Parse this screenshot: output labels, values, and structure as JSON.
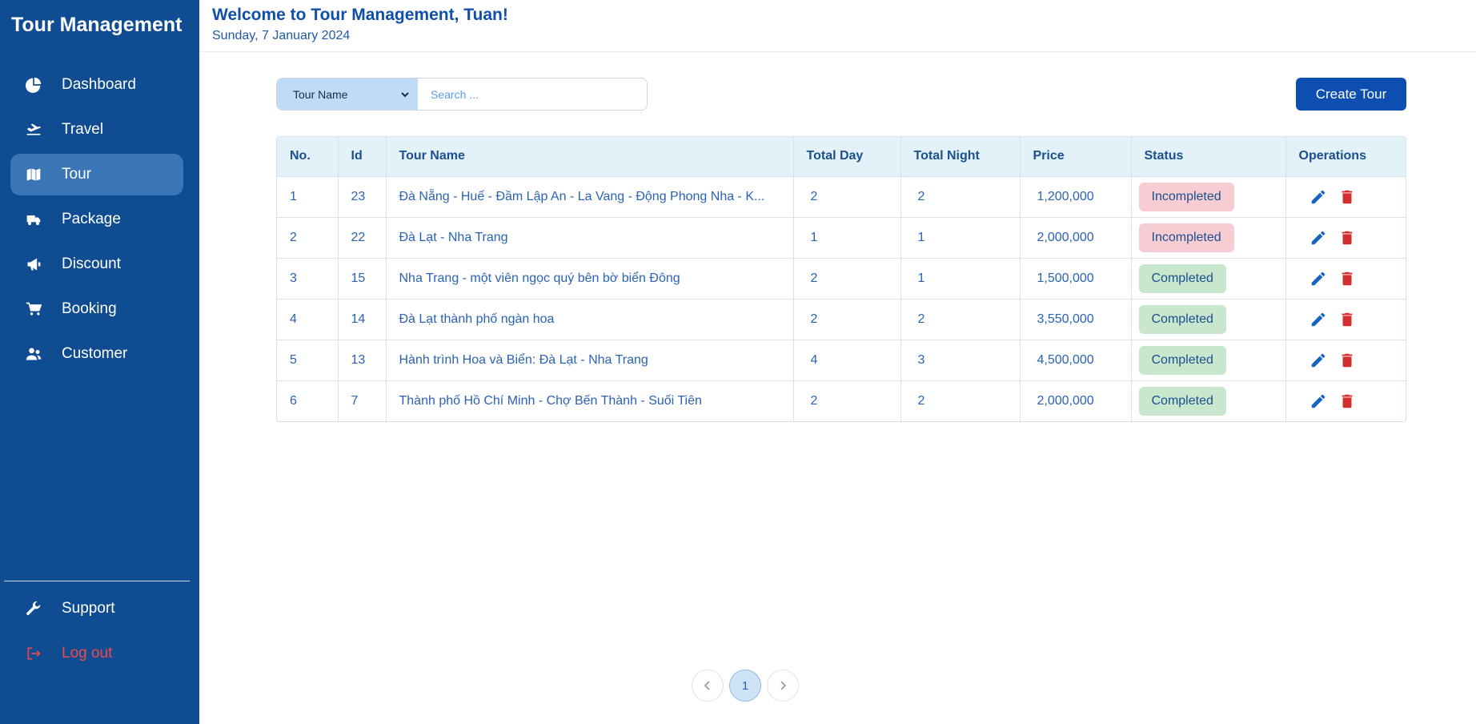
{
  "sidebar": {
    "brand": "Tour Management",
    "items": [
      {
        "label": "Dashboard",
        "icon": "pie-chart-icon"
      },
      {
        "label": "Travel",
        "icon": "plane-icon"
      },
      {
        "label": "Tour",
        "icon": "map-icon",
        "active": true
      },
      {
        "label": "Package",
        "icon": "truck-icon"
      },
      {
        "label": "Discount",
        "icon": "megaphone-icon"
      },
      {
        "label": "Booking",
        "icon": "cart-icon"
      },
      {
        "label": "Customer",
        "icon": "users-icon"
      }
    ],
    "support_label": "Support",
    "logout_label": "Log out"
  },
  "header": {
    "welcome": "Welcome to Tour Management, Tuan!",
    "date": "Sunday, 7 January 2024"
  },
  "search": {
    "select_value": "Tour Name",
    "placeholder": "Search ..."
  },
  "create_label": "Create Tour",
  "table": {
    "columns": [
      "No.",
      "Id",
      "Tour Name",
      "Total Day",
      "Total Night",
      "Price",
      "Status",
      "Operations"
    ],
    "rows": [
      {
        "no": "1",
        "id": "23",
        "name": "Đà Nẵng - Huế - Đầm Lập An - La Vang - Động Phong Nha - K...",
        "day": "2",
        "night": "2",
        "price": "1,200,000",
        "status": "Incompleted"
      },
      {
        "no": "2",
        "id": "22",
        "name": "Đà Lạt - Nha Trang",
        "day": "1",
        "night": "1",
        "price": "2,000,000",
        "status": "Incompleted"
      },
      {
        "no": "3",
        "id": "15",
        "name": "Nha Trang - một viên ngọc quý bên bờ biển Đông",
        "day": "2",
        "night": "1",
        "price": "1,500,000",
        "status": "Completed"
      },
      {
        "no": "4",
        "id": "14",
        "name": "Đà Lạt thành phố ngàn hoa",
        "day": "2",
        "night": "2",
        "price": "3,550,000",
        "status": "Completed"
      },
      {
        "no": "5",
        "id": "13",
        "name": "Hành trình Hoa và Biển: Đà Lạt - Nha Trang",
        "day": "4",
        "night": "3",
        "price": "4,500,000",
        "status": "Completed"
      },
      {
        "no": "6",
        "id": "7",
        "name": "Thành phố Hồ Chí Minh - Chợ Bến Thành - Suối Tiên",
        "day": "2",
        "night": "2",
        "price": "2,000,000",
        "status": "Completed"
      }
    ]
  },
  "pagination": {
    "current": "1"
  },
  "colors": {
    "sidebar": "#0f4c91",
    "accent": "#0d4fb0",
    "edit": "#1565c0",
    "delete": "#d32f2f",
    "logout": "#ee4b4b"
  }
}
